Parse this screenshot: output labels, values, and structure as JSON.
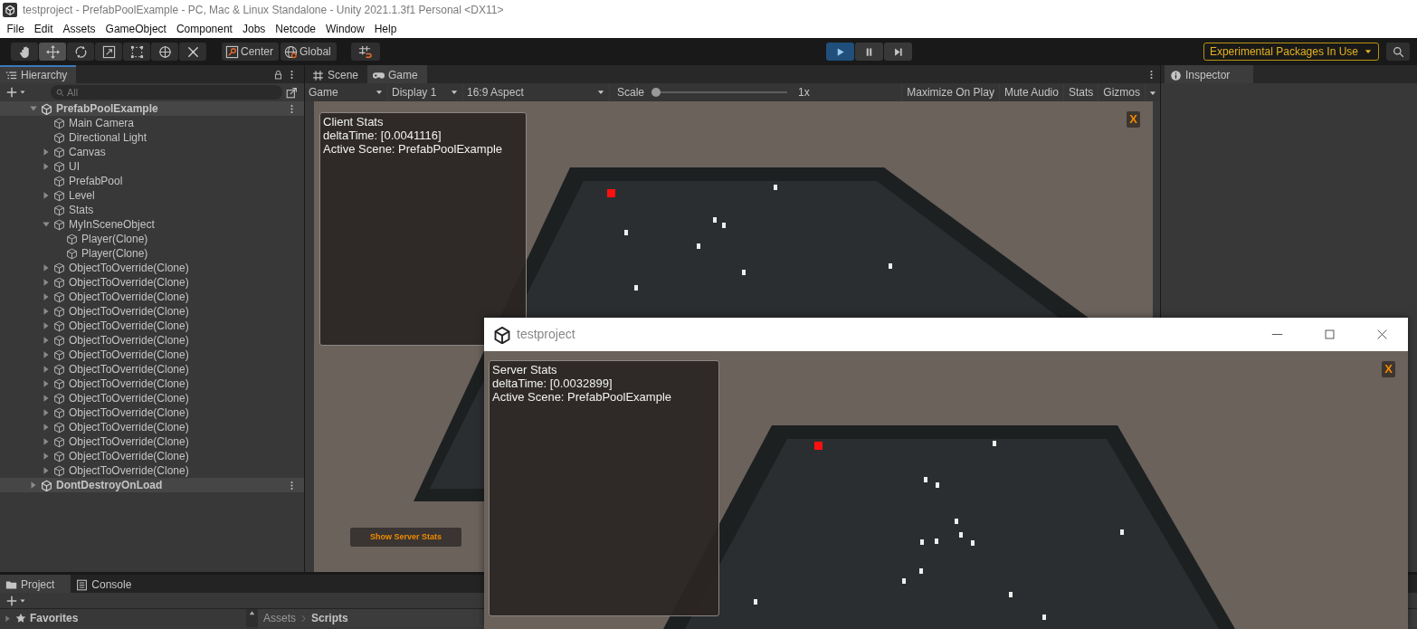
{
  "window": {
    "title": "testproject - PrefabPoolExample - PC, Mac & Linux Standalone - Unity 2021.1.3f1 Personal <DX11>"
  },
  "menu": [
    "File",
    "Edit",
    "Assets",
    "GameObject",
    "Component",
    "Jobs",
    "Netcode",
    "Window",
    "Help"
  ],
  "toolbar": {
    "tools": [
      {
        "kind": "hand",
        "selected": false
      },
      {
        "kind": "move",
        "selected": true
      },
      {
        "kind": "rotate",
        "selected": false
      },
      {
        "kind": "scale",
        "selected": false
      },
      {
        "kind": "rect",
        "selected": false
      },
      {
        "kind": "transform",
        "selected": false
      },
      {
        "kind": "custom",
        "selected": false
      }
    ],
    "pivot": [
      {
        "kind": "center",
        "label": "Center"
      },
      {
        "kind": "global",
        "label": "Global"
      }
    ],
    "play": [
      {
        "kind": "play",
        "selected": true
      },
      {
        "kind": "pause",
        "selected": false
      },
      {
        "kind": "step",
        "selected": false
      }
    ],
    "experimental": "Experimental Packages In Use"
  },
  "hierarchy": {
    "tab": {
      "label": "Hierarchy",
      "selected": true
    },
    "search": {
      "placeholder": "All"
    },
    "tree": [
      {
        "label": "PrefabPoolExample",
        "kind": "scene",
        "expanded": true,
        "children": [
          {
            "label": "Main Camera",
            "kind": "object"
          },
          {
            "label": "Directional Light",
            "kind": "object"
          },
          {
            "label": "Canvas",
            "kind": "object",
            "expanded": false
          },
          {
            "label": "UI",
            "kind": "object",
            "expanded": false
          },
          {
            "label": "PrefabPool",
            "kind": "object"
          },
          {
            "label": "Level",
            "kind": "object",
            "expanded": false
          },
          {
            "label": "Stats",
            "kind": "object"
          },
          {
            "label": "MyInSceneObject",
            "kind": "object",
            "expanded": true,
            "children": [
              {
                "label": "Player(Clone)",
                "kind": "object"
              },
              {
                "label": "Player(Clone)",
                "kind": "object"
              }
            ]
          },
          {
            "label": "ObjectToOverride(Clone)",
            "kind": "object",
            "expanded": false
          },
          {
            "label": "ObjectToOverride(Clone)",
            "kind": "object",
            "expanded": false
          },
          {
            "label": "ObjectToOverride(Clone)",
            "kind": "object",
            "expanded": false
          },
          {
            "label": "ObjectToOverride(Clone)",
            "kind": "object",
            "expanded": false
          },
          {
            "label": "ObjectToOverride(Clone)",
            "kind": "object",
            "expanded": false
          },
          {
            "label": "ObjectToOverride(Clone)",
            "kind": "object",
            "expanded": false
          },
          {
            "label": "ObjectToOverride(Clone)",
            "kind": "object",
            "expanded": false
          },
          {
            "label": "ObjectToOverride(Clone)",
            "kind": "object",
            "expanded": false
          },
          {
            "label": "ObjectToOverride(Clone)",
            "kind": "object",
            "expanded": false
          },
          {
            "label": "ObjectToOverride(Clone)",
            "kind": "object",
            "expanded": false
          },
          {
            "label": "ObjectToOverride(Clone)",
            "kind": "object",
            "expanded": false
          },
          {
            "label": "ObjectToOverride(Clone)",
            "kind": "object",
            "expanded": false
          },
          {
            "label": "ObjectToOverride(Clone)",
            "kind": "object",
            "expanded": false
          },
          {
            "label": "ObjectToOverride(Clone)",
            "kind": "object",
            "expanded": false
          },
          {
            "label": "ObjectToOverride(Clone)",
            "kind": "object",
            "expanded": false
          }
        ]
      },
      {
        "label": "DontDestroyOnLoad",
        "kind": "scene",
        "expanded": false
      }
    ]
  },
  "game_panel": {
    "tabs": [
      {
        "label": "Scene",
        "kind": "scene",
        "selected": false
      },
      {
        "label": "Game",
        "kind": "game",
        "selected": true
      }
    ],
    "dropdowns": [
      "Game",
      "Display 1",
      "16:9 Aspect"
    ],
    "scale": {
      "label": "Scale",
      "level": 0,
      "reading": "1x"
    },
    "toggles": [
      {
        "label": "Maximize On Play",
        "on": false
      },
      {
        "label": "Mute Audio",
        "on": false
      },
      {
        "label": "Stats",
        "on": false
      },
      {
        "label": "Gizmos",
        "on": false
      }
    ],
    "client_stats": [
      "Client Stats",
      "deltaTime: [0.0041116]",
      "Active Scene: PrefabPoolExample"
    ],
    "close_button": "X",
    "server_button": "Show Server Stats"
  },
  "inspector": {
    "tab": {
      "label": "Inspector",
      "selected": true
    }
  },
  "project_panel": {
    "tabs": [
      {
        "label": "Project",
        "kind": "project",
        "selected": true
      },
      {
        "label": "Console",
        "kind": "console",
        "selected": false
      }
    ],
    "favorites": "Favorites",
    "breadcrumb": [
      "Assets",
      "Scripts"
    ]
  },
  "server_window": {
    "title": "testproject",
    "stats": [
      "Server Stats",
      "deltaTime: [0.0032899]",
      "Active Scene: PrefabPoolExample"
    ],
    "close_button": "X"
  }
}
